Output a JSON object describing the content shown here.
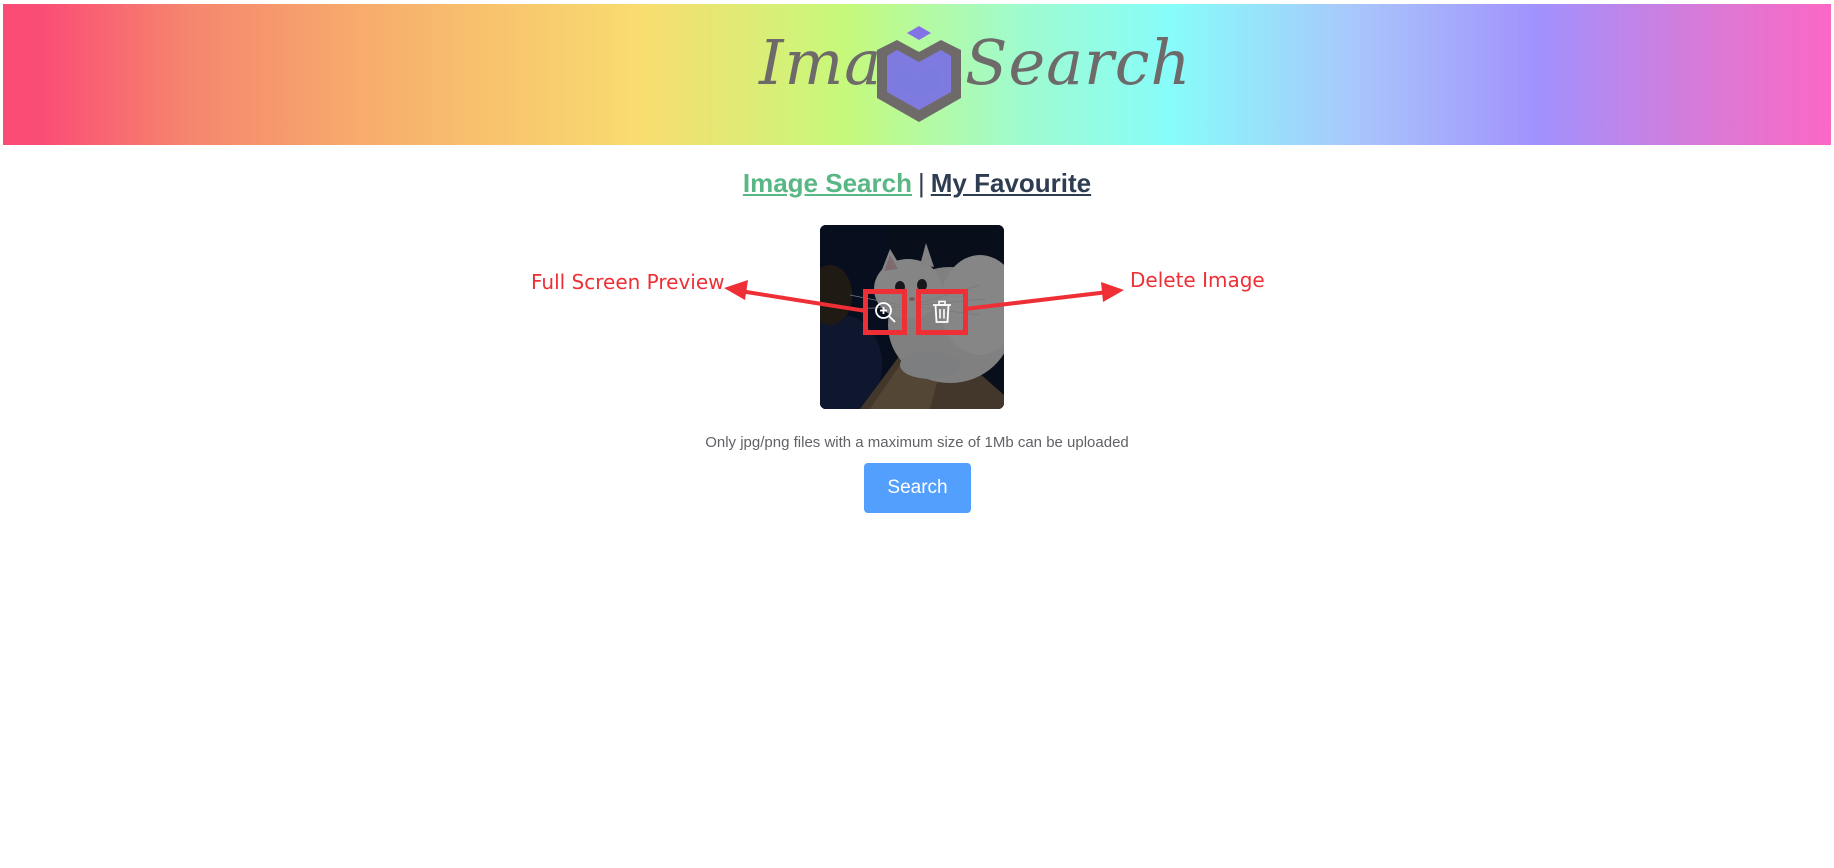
{
  "header": {
    "logo_left_word": "Image",
    "logo_right_word": "Search",
    "logo_icon": "hexagon-cube-icon"
  },
  "nav": {
    "image_search": "Image Search",
    "separator": "|",
    "my_favourite": "My Favourite"
  },
  "upload": {
    "thumbnail_icon": "kitten-photo",
    "zoom_icon": "zoom-in-icon",
    "delete_icon": "trash-icon",
    "hint": "Only jpg/png files with a maximum size of 1Mb can be uploaded"
  },
  "annotations": {
    "preview_label": "Full Screen Preview",
    "delete_label": "Delete Image",
    "color": "#ee2f36"
  },
  "actions": {
    "search_label": "Search"
  },
  "colors": {
    "nav_active": "#58b784",
    "nav_inactive": "#2f3d52",
    "primary_button": "#539ffd"
  }
}
